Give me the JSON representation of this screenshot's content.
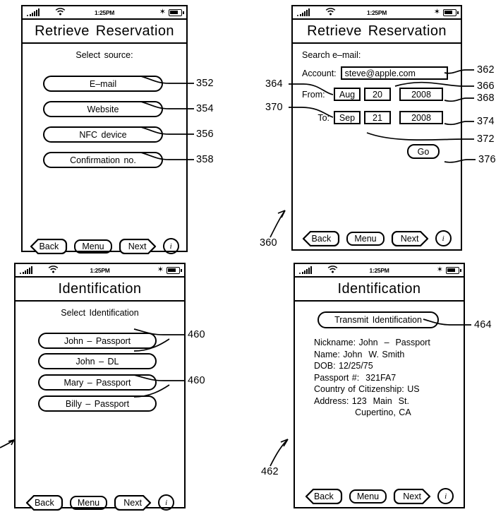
{
  "figure": {
    "kind": "patent-figure",
    "statusbar": {
      "time": "1:25PM",
      "icons": [
        "signal-bars-icon",
        "wifi-icon",
        "bluetooth-icon",
        "battery-icon"
      ],
      "bluetooth_glyph": "✶"
    },
    "nav": {
      "back": "Back",
      "menu": "Menu",
      "next": "Next",
      "info": "i"
    }
  },
  "phone1": {
    "title": "Retrieve  Reservation",
    "subhead": "Select source:",
    "options": [
      {
        "label": "E–mail",
        "ref": "352"
      },
      {
        "label": "Website",
        "ref": "354"
      },
      {
        "label": "NFC  device",
        "ref": "356"
      },
      {
        "label": "Confirmation  no.",
        "ref": "358"
      }
    ]
  },
  "phone2": {
    "title": "Retrieve  Reservation",
    "subhead": "Search  e–mail:",
    "account_label": "Account:",
    "account_value": "steve@apple.com",
    "from_label": "From:",
    "from_month": "Aug",
    "from_day": "20",
    "from_year": "2008",
    "to_label": "To:",
    "to_month": "Sep",
    "to_day": "21",
    "to_year": "2008",
    "go_label": "Go",
    "refs": {
      "screen": "360",
      "account": "362",
      "from_label_ref": "364",
      "from_month_ref": "366",
      "from_year_ref": "368",
      "to_label_ref": "370",
      "to_day_ref": "372",
      "to_year_ref": "374",
      "go_ref": "376"
    }
  },
  "phone3": {
    "title": "Identification",
    "subhead": "Select Identification",
    "options": [
      {
        "label": "John  –  Passport"
      },
      {
        "label": "John  –  DL"
      },
      {
        "label": "Mary  –  Passport"
      },
      {
        "label": "Billy  –  Passport"
      }
    ],
    "refs": {
      "group_a": "460",
      "group_b": "460"
    }
  },
  "phone4": {
    "title": "Identification",
    "transmit_label": "Transmit Identification",
    "details": [
      "Nickname: John  –  Passport",
      "Name: John  W. Smith",
      "DOB: 12/25/75",
      "Passport #:  321FA7",
      "Country of Citizenship: US",
      "Address: 123  Main  St.",
      "             Cupertino, CA"
    ],
    "refs": {
      "screen": "462",
      "transmit": "464"
    }
  }
}
